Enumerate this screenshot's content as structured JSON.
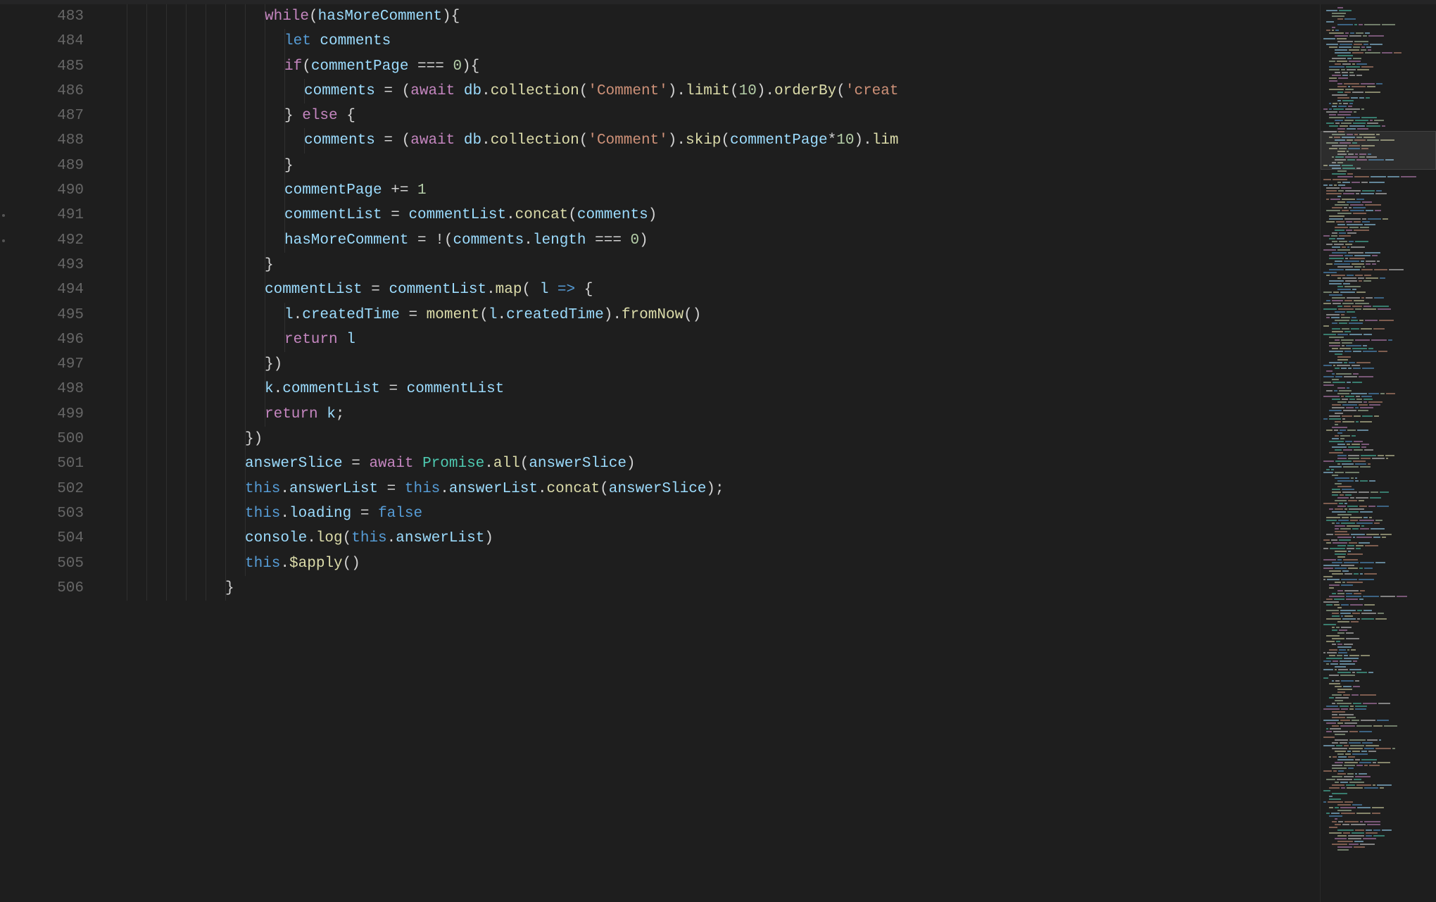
{
  "lineStart": 483,
  "lineEnd": 506,
  "code": {
    "l483": {
      "indent": 8,
      "tokens": [
        {
          "t": "while",
          "c": "kw"
        },
        {
          "t": "(",
          "c": "punc"
        },
        {
          "t": "hasMoreComment",
          "c": "var"
        },
        {
          "t": "){",
          "c": "punc"
        }
      ]
    },
    "l484": {
      "indent": 9,
      "tokens": [
        {
          "t": "let",
          "c": "const"
        },
        {
          "t": " ",
          "c": ""
        },
        {
          "t": "comments",
          "c": "var"
        }
      ]
    },
    "l485": {
      "indent": 9,
      "tokens": [
        {
          "t": "if",
          "c": "kw"
        },
        {
          "t": "(",
          "c": "punc"
        },
        {
          "t": "commentPage",
          "c": "var"
        },
        {
          "t": " === ",
          "c": "op"
        },
        {
          "t": "0",
          "c": "num"
        },
        {
          "t": "){",
          "c": "punc"
        }
      ]
    },
    "l486": {
      "indent": 10,
      "tokens": [
        {
          "t": "comments",
          "c": "var"
        },
        {
          "t": " = (",
          "c": "op"
        },
        {
          "t": "await",
          "c": "kw"
        },
        {
          "t": " ",
          "c": ""
        },
        {
          "t": "db",
          "c": "var"
        },
        {
          "t": ".",
          "c": "punc"
        },
        {
          "t": "collection",
          "c": "fn"
        },
        {
          "t": "(",
          "c": "punc"
        },
        {
          "t": "'Comment'",
          "c": "str"
        },
        {
          "t": ").",
          "c": "punc"
        },
        {
          "t": "limit",
          "c": "fn"
        },
        {
          "t": "(",
          "c": "punc"
        },
        {
          "t": "10",
          "c": "num"
        },
        {
          "t": ").",
          "c": "punc"
        },
        {
          "t": "orderBy",
          "c": "fn"
        },
        {
          "t": "(",
          "c": "punc"
        },
        {
          "t": "'creat",
          "c": "str"
        }
      ]
    },
    "l487": {
      "indent": 9,
      "tokens": [
        {
          "t": "} ",
          "c": "punc"
        },
        {
          "t": "else",
          "c": "kw"
        },
        {
          "t": " {",
          "c": "punc"
        }
      ]
    },
    "l488": {
      "indent": 10,
      "tokens": [
        {
          "t": "comments",
          "c": "var"
        },
        {
          "t": " = (",
          "c": "op"
        },
        {
          "t": "await",
          "c": "kw"
        },
        {
          "t": " ",
          "c": ""
        },
        {
          "t": "db",
          "c": "var"
        },
        {
          "t": ".",
          "c": "punc"
        },
        {
          "t": "collection",
          "c": "fn"
        },
        {
          "t": "(",
          "c": "punc"
        },
        {
          "t": "'Comment'",
          "c": "str"
        },
        {
          "t": ").",
          "c": "punc"
        },
        {
          "t": "skip",
          "c": "fn"
        },
        {
          "t": "(",
          "c": "punc"
        },
        {
          "t": "commentPage",
          "c": "var"
        },
        {
          "t": "*",
          "c": "op"
        },
        {
          "t": "10",
          "c": "num"
        },
        {
          "t": ").",
          "c": "punc"
        },
        {
          "t": "lim",
          "c": "fn"
        }
      ]
    },
    "l489": {
      "indent": 9,
      "tokens": [
        {
          "t": "}",
          "c": "punc"
        }
      ]
    },
    "l490": {
      "indent": 9,
      "tokens": [
        {
          "t": "commentPage",
          "c": "var"
        },
        {
          "t": " += ",
          "c": "op"
        },
        {
          "t": "1",
          "c": "num"
        }
      ]
    },
    "l491": {
      "indent": 9,
      "tokens": [
        {
          "t": "commentList",
          "c": "var"
        },
        {
          "t": " = ",
          "c": "op"
        },
        {
          "t": "commentList",
          "c": "var"
        },
        {
          "t": ".",
          "c": "punc"
        },
        {
          "t": "concat",
          "c": "fn"
        },
        {
          "t": "(",
          "c": "punc"
        },
        {
          "t": "comments",
          "c": "var"
        },
        {
          "t": ")",
          "c": "punc"
        }
      ]
    },
    "l492": {
      "indent": 9,
      "tokens": [
        {
          "t": "hasMoreComment",
          "c": "var"
        },
        {
          "t": " = !(",
          "c": "op"
        },
        {
          "t": "comments",
          "c": "var"
        },
        {
          "t": ".",
          "c": "punc"
        },
        {
          "t": "length",
          "c": "prop"
        },
        {
          "t": " === ",
          "c": "op"
        },
        {
          "t": "0",
          "c": "num"
        },
        {
          "t": ")",
          "c": "punc"
        }
      ]
    },
    "l493": {
      "indent": 8,
      "tokens": [
        {
          "t": "}",
          "c": "punc"
        }
      ]
    },
    "l494": {
      "indent": 8,
      "tokens": [
        {
          "t": "commentList",
          "c": "var"
        },
        {
          "t": " = ",
          "c": "op"
        },
        {
          "t": "commentList",
          "c": "var"
        },
        {
          "t": ".",
          "c": "punc"
        },
        {
          "t": "map",
          "c": "fn"
        },
        {
          "t": "( ",
          "c": "punc"
        },
        {
          "t": "l",
          "c": "var"
        },
        {
          "t": " ",
          "c": ""
        },
        {
          "t": "=>",
          "c": "const"
        },
        {
          "t": " {",
          "c": "punc"
        }
      ]
    },
    "l495": {
      "indent": 9,
      "tokens": [
        {
          "t": "l",
          "c": "var"
        },
        {
          "t": ".",
          "c": "punc"
        },
        {
          "t": "createdTime",
          "c": "prop"
        },
        {
          "t": " = ",
          "c": "op"
        },
        {
          "t": "moment",
          "c": "fn"
        },
        {
          "t": "(",
          "c": "punc"
        },
        {
          "t": "l",
          "c": "var"
        },
        {
          "t": ".",
          "c": "punc"
        },
        {
          "t": "createdTime",
          "c": "prop"
        },
        {
          "t": ").",
          "c": "punc"
        },
        {
          "t": "fromNow",
          "c": "fn"
        },
        {
          "t": "()",
          "c": "punc"
        }
      ]
    },
    "l496": {
      "indent": 9,
      "tokens": [
        {
          "t": "return",
          "c": "kw"
        },
        {
          "t": " ",
          "c": ""
        },
        {
          "t": "l",
          "c": "var"
        }
      ]
    },
    "l497": {
      "indent": 8,
      "tokens": [
        {
          "t": "})",
          "c": "punc"
        }
      ]
    },
    "l498": {
      "indent": 8,
      "tokens": [
        {
          "t": "k",
          "c": "var"
        },
        {
          "t": ".",
          "c": "punc"
        },
        {
          "t": "commentList",
          "c": "prop"
        },
        {
          "t": " = ",
          "c": "op"
        },
        {
          "t": "commentList",
          "c": "var"
        }
      ]
    },
    "l499": {
      "indent": 8,
      "tokens": [
        {
          "t": "return",
          "c": "kw"
        },
        {
          "t": " ",
          "c": ""
        },
        {
          "t": "k",
          "c": "var"
        },
        {
          "t": ";",
          "c": "punc"
        }
      ]
    },
    "l500": {
      "indent": 7,
      "tokens": [
        {
          "t": "})",
          "c": "punc"
        }
      ]
    },
    "l501": {
      "indent": 7,
      "tokens": [
        {
          "t": "answerSlice",
          "c": "var"
        },
        {
          "t": " = ",
          "c": "op"
        },
        {
          "t": "await",
          "c": "kw"
        },
        {
          "t": " ",
          "c": ""
        },
        {
          "t": "Promise",
          "c": "obj"
        },
        {
          "t": ".",
          "c": "punc"
        },
        {
          "t": "all",
          "c": "fn"
        },
        {
          "t": "(",
          "c": "punc"
        },
        {
          "t": "answerSlice",
          "c": "var"
        },
        {
          "t": ")",
          "c": "punc"
        }
      ]
    },
    "l502": {
      "indent": 7,
      "tokens": [
        {
          "t": "this",
          "c": "this"
        },
        {
          "t": ".",
          "c": "punc"
        },
        {
          "t": "answerList",
          "c": "prop"
        },
        {
          "t": " = ",
          "c": "op"
        },
        {
          "t": "this",
          "c": "this"
        },
        {
          "t": ".",
          "c": "punc"
        },
        {
          "t": "answerList",
          "c": "prop"
        },
        {
          "t": ".",
          "c": "punc"
        },
        {
          "t": "concat",
          "c": "fn"
        },
        {
          "t": "(",
          "c": "punc"
        },
        {
          "t": "answerSlice",
          "c": "var"
        },
        {
          "t": ");",
          "c": "punc"
        }
      ]
    },
    "l503": {
      "indent": 7,
      "tokens": [
        {
          "t": "this",
          "c": "this"
        },
        {
          "t": ".",
          "c": "punc"
        },
        {
          "t": "loading",
          "c": "prop"
        },
        {
          "t": " = ",
          "c": "op"
        },
        {
          "t": "false",
          "c": "const"
        }
      ]
    },
    "l504": {
      "indent": 7,
      "tokens": [
        {
          "t": "console",
          "c": "var"
        },
        {
          "t": ".",
          "c": "punc"
        },
        {
          "t": "log",
          "c": "fn"
        },
        {
          "t": "(",
          "c": "punc"
        },
        {
          "t": "this",
          "c": "this"
        },
        {
          "t": ".",
          "c": "punc"
        },
        {
          "t": "answerList",
          "c": "prop"
        },
        {
          "t": ")",
          "c": "punc"
        }
      ]
    },
    "l505": {
      "indent": 7,
      "tokens": [
        {
          "t": "this",
          "c": "this"
        },
        {
          "t": ".",
          "c": "punc"
        },
        {
          "t": "$apply",
          "c": "fn"
        },
        {
          "t": "()",
          "c": "punc"
        }
      ]
    },
    "l506": {
      "indent": 6,
      "tokens": [
        {
          "t": "}",
          "c": "punc"
        }
      ]
    }
  },
  "indentSize": 2,
  "decorationDots": [
    491,
    492
  ]
}
